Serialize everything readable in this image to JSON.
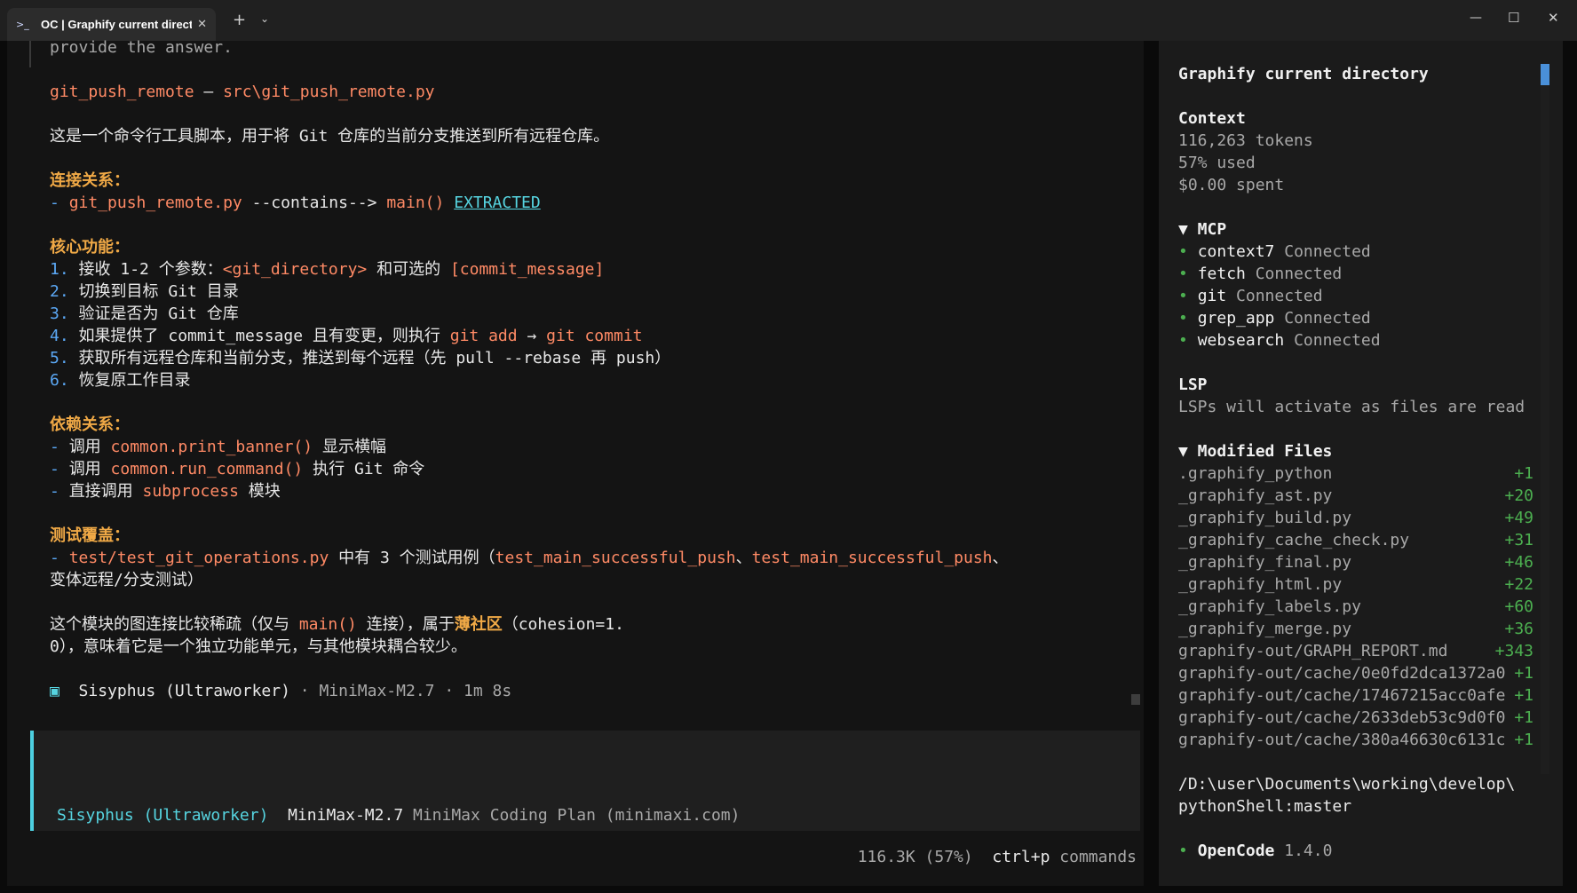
{
  "window": {
    "tab_icon": "terminal-icon",
    "tab_title": "OC | Graphify current directory",
    "tab_close": "✕",
    "new_tab": "+",
    "tab_dropdown": "⌄",
    "minimize": "—",
    "maximize": "☐",
    "close": "✕"
  },
  "transcript": {
    "lines": [
      [
        {
          "t": "provide the answer.",
          "c": "muted"
        }
      ],
      [],
      [
        {
          "t": "git_push_remote",
          "c": "orange"
        },
        {
          "t": " — ",
          "c": "text"
        },
        {
          "t": "src\\git_push_remote.py",
          "c": "orange"
        }
      ],
      [],
      [
        {
          "t": "这是一个命令行工具脚本，用于将 Git 仓库的当前分支推送到所有远程仓库。",
          "c": "text"
        }
      ],
      [],
      [
        {
          "t": "连接关系：",
          "c": "accent"
        }
      ],
      [
        {
          "t": "- ",
          "c": "num"
        },
        {
          "t": "git_push_remote.py",
          "c": "orange"
        },
        {
          "t": " --contains--> ",
          "c": "text"
        },
        {
          "t": "main()",
          "c": "orange"
        },
        {
          "t": " ",
          "c": "text"
        },
        {
          "t": "EXTRACTED",
          "c": "link"
        }
      ],
      [],
      [
        {
          "t": "核心功能：",
          "c": "accent"
        }
      ],
      [
        {
          "t": "1. ",
          "c": "num"
        },
        {
          "t": "接收 1-2 个参数：",
          "c": "text"
        },
        {
          "t": "<git_directory>",
          "c": "orange"
        },
        {
          "t": " 和可选的 ",
          "c": "text"
        },
        {
          "t": "[commit_message]",
          "c": "orange"
        }
      ],
      [
        {
          "t": "2. ",
          "c": "num"
        },
        {
          "t": "切换到目标 Git 目录",
          "c": "text"
        }
      ],
      [
        {
          "t": "3. ",
          "c": "num"
        },
        {
          "t": "验证是否为 Git 仓库",
          "c": "text"
        }
      ],
      [
        {
          "t": "4. ",
          "c": "num"
        },
        {
          "t": "如果提供了 commit_message 且有变更，则执行 ",
          "c": "text"
        },
        {
          "t": "git add",
          "c": "orange"
        },
        {
          "t": " → ",
          "c": "text"
        },
        {
          "t": "git commit",
          "c": "orange"
        }
      ],
      [
        {
          "t": "5. ",
          "c": "num"
        },
        {
          "t": "获取所有远程仓库和当前分支，推送到每个远程（先 pull --rebase 再 push）",
          "c": "text"
        }
      ],
      [
        {
          "t": "6. ",
          "c": "num"
        },
        {
          "t": "恢复原工作目录",
          "c": "text"
        }
      ],
      [],
      [
        {
          "t": "依赖关系：",
          "c": "accent"
        }
      ],
      [
        {
          "t": "- ",
          "c": "num"
        },
        {
          "t": "调用 ",
          "c": "text"
        },
        {
          "t": "common.print_banner()",
          "c": "orange"
        },
        {
          "t": " 显示横幅",
          "c": "text"
        }
      ],
      [
        {
          "t": "- ",
          "c": "num"
        },
        {
          "t": "调用 ",
          "c": "text"
        },
        {
          "t": "common.run_command()",
          "c": "orange"
        },
        {
          "t": " 执行 Git 命令",
          "c": "text"
        }
      ],
      [
        {
          "t": "- ",
          "c": "num"
        },
        {
          "t": "直接调用 ",
          "c": "text"
        },
        {
          "t": "subprocess",
          "c": "orange"
        },
        {
          "t": " 模块",
          "c": "text"
        }
      ],
      [],
      [
        {
          "t": "测试覆盖：",
          "c": "accent"
        }
      ],
      [
        {
          "t": "- ",
          "c": "num"
        },
        {
          "t": "test/test_git_operations.py",
          "c": "orange"
        },
        {
          "t": " 中有 3 个测试用例（",
          "c": "text"
        },
        {
          "t": "test_main_successful_push",
          "c": "orange"
        },
        {
          "t": "、",
          "c": "text"
        },
        {
          "t": "test_main_successful_push",
          "c": "orange"
        },
        {
          "t": "、",
          "c": "text"
        }
      ],
      [
        {
          "t": "变体远程/分支测试）",
          "c": "text"
        }
      ],
      [],
      [
        {
          "t": "这个模块的图连接比较稀疏（仅与 ",
          "c": "text"
        },
        {
          "t": "main()",
          "c": "orange"
        },
        {
          "t": " 连接），属于",
          "c": "text"
        },
        {
          "t": "薄社区",
          "c": "accent"
        },
        {
          "t": "（cohesion=1.",
          "c": "text"
        }
      ],
      [
        {
          "t": "0），意味着它是一个独立功能单元，与其他模块耦合较少。",
          "c": "text"
        }
      ],
      [],
      [
        {
          "t": "▣ ",
          "c": "cyan"
        },
        {
          "t": " Sisyphus (Ultraworker)",
          "c": "text"
        },
        {
          "t": " · MiniMax-M2.7 · 1m 8s",
          "c": "muted"
        }
      ]
    ]
  },
  "prompt": {
    "agent": "Sisyphus (Ultraworker)",
    "model": "MiniMax-M2.7",
    "provider": "MiniMax Coding Plan (minimaxi.com)"
  },
  "footer": {
    "usage": "116.3K (57%)",
    "shortcut": "ctrl+p",
    "shortcut_label": "commands"
  },
  "sidebar": {
    "title": "Graphify current directory",
    "context": {
      "heading": "Context",
      "tokens": "116,263 tokens",
      "used": "57% used",
      "spent": "$0.00 spent"
    },
    "mcp": {
      "heading": "▼ MCP",
      "servers": [
        {
          "name": "context7",
          "status": "Connected"
        },
        {
          "name": "fetch",
          "status": "Connected"
        },
        {
          "name": "git",
          "status": "Connected"
        },
        {
          "name": "grep_app",
          "status": "Connected"
        },
        {
          "name": "websearch",
          "status": "Connected"
        }
      ]
    },
    "lsp": {
      "heading": "LSP",
      "note": "LSPs will activate as files are read"
    },
    "modified": {
      "heading": "▼ Modified Files",
      "files": [
        {
          "name": ".graphify_python",
          "add": "+1"
        },
        {
          "name": "_graphify_ast.py",
          "add": "+20"
        },
        {
          "name": "_graphify_build.py",
          "add": "+49"
        },
        {
          "name": "_graphify_cache_check.py",
          "add": "+31"
        },
        {
          "name": "_graphify_final.py",
          "add": "+46"
        },
        {
          "name": "_graphify_html.py",
          "add": "+22"
        },
        {
          "name": "_graphify_labels.py",
          "add": "+60"
        },
        {
          "name": "_graphify_merge.py",
          "add": "+36"
        },
        {
          "name": "graphify-out/GRAPH_REPORT.md",
          "add": "+343"
        },
        {
          "name": "graphify-out/cache/0e0fd2dca1372a0",
          "add": "+1"
        },
        {
          "name": "graphify-out/cache/17467215acc0afe",
          "add": "+1"
        },
        {
          "name": "graphify-out/cache/2633deb53c9d0f0",
          "add": "+1"
        },
        {
          "name": "graphify-out/cache/380a46630c6131c",
          "add": "+1"
        }
      ]
    },
    "path_line1": "/D:\\user\\Documents\\working\\develop\\",
    "path_line2": "pythonShell:master",
    "app_name": "OpenCode",
    "app_version": "1.4.0"
  }
}
